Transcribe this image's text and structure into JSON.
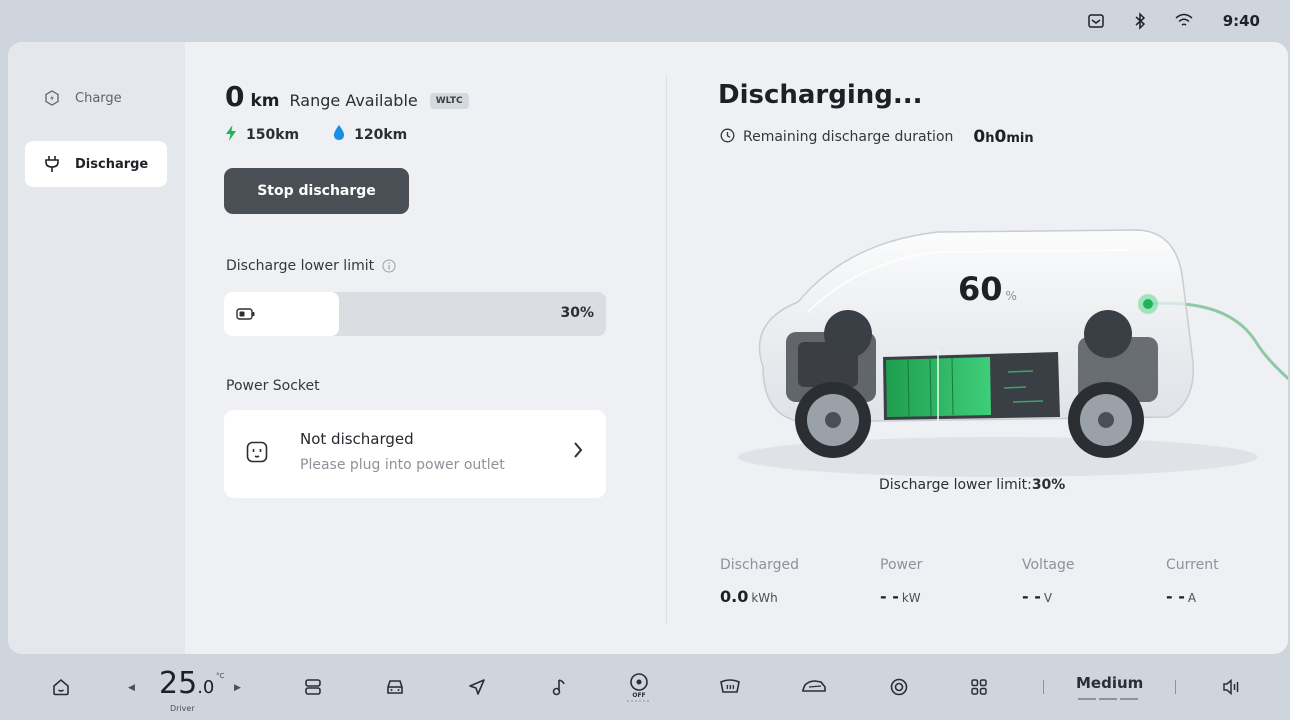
{
  "status_bar": {
    "time": "9:40",
    "icons": [
      "message-icon",
      "bluetooth-icon",
      "wifi-icon"
    ]
  },
  "sidebar": {
    "items": [
      {
        "label": "Charge",
        "icon": "charge-icon",
        "active": false
      },
      {
        "label": "Discharge",
        "icon": "plug-icon",
        "active": true
      }
    ]
  },
  "range": {
    "value": "0",
    "unit": "km",
    "label": "Range Available",
    "badge": "WLTC",
    "electric": "150km",
    "fuel": "120km"
  },
  "stop_button": "Stop discharge",
  "lower_limit": {
    "label": "Discharge lower limit",
    "value": "30%",
    "level": 0.3
  },
  "power_socket": {
    "title": "Power Socket",
    "status": "Not discharged",
    "hint": "Please plug into power outlet"
  },
  "discharge": {
    "title": "Discharging...",
    "remaining_label": "Remaining discharge duration",
    "hours": "0",
    "h_unit": "h",
    "minutes": "0",
    "min_unit": "min",
    "battery_pct": "60",
    "pct_unit": "%",
    "limit_caption": "Discharge lower limit:",
    "limit_value": "30%"
  },
  "stats": [
    {
      "label": "Discharged",
      "value": "0.0",
      "unit": "kWh"
    },
    {
      "label": "Power",
      "value": "- -",
      "unit": "kW"
    },
    {
      "label": "Voltage",
      "value": "- -",
      "unit": "V"
    },
    {
      "label": "Current",
      "value": "- -",
      "unit": "A"
    }
  ],
  "dock": {
    "temp_int": "25",
    "temp_dec": ".0",
    "temp_unit": "°C",
    "temp_label": "Driver",
    "fan": "Medium",
    "icons": [
      "home-icon",
      "seat-heat-icon",
      "car-front-icon",
      "navigation-icon",
      "music-icon",
      "steering-off-icon",
      "defrost-icon",
      "car-side-icon",
      "record-icon",
      "apps-icon",
      "volume-icon"
    ]
  },
  "colors": {
    "accent_green": "#1fb35a",
    "water_blue": "#1a8ee0",
    "button_dark": "#4a4f55"
  }
}
